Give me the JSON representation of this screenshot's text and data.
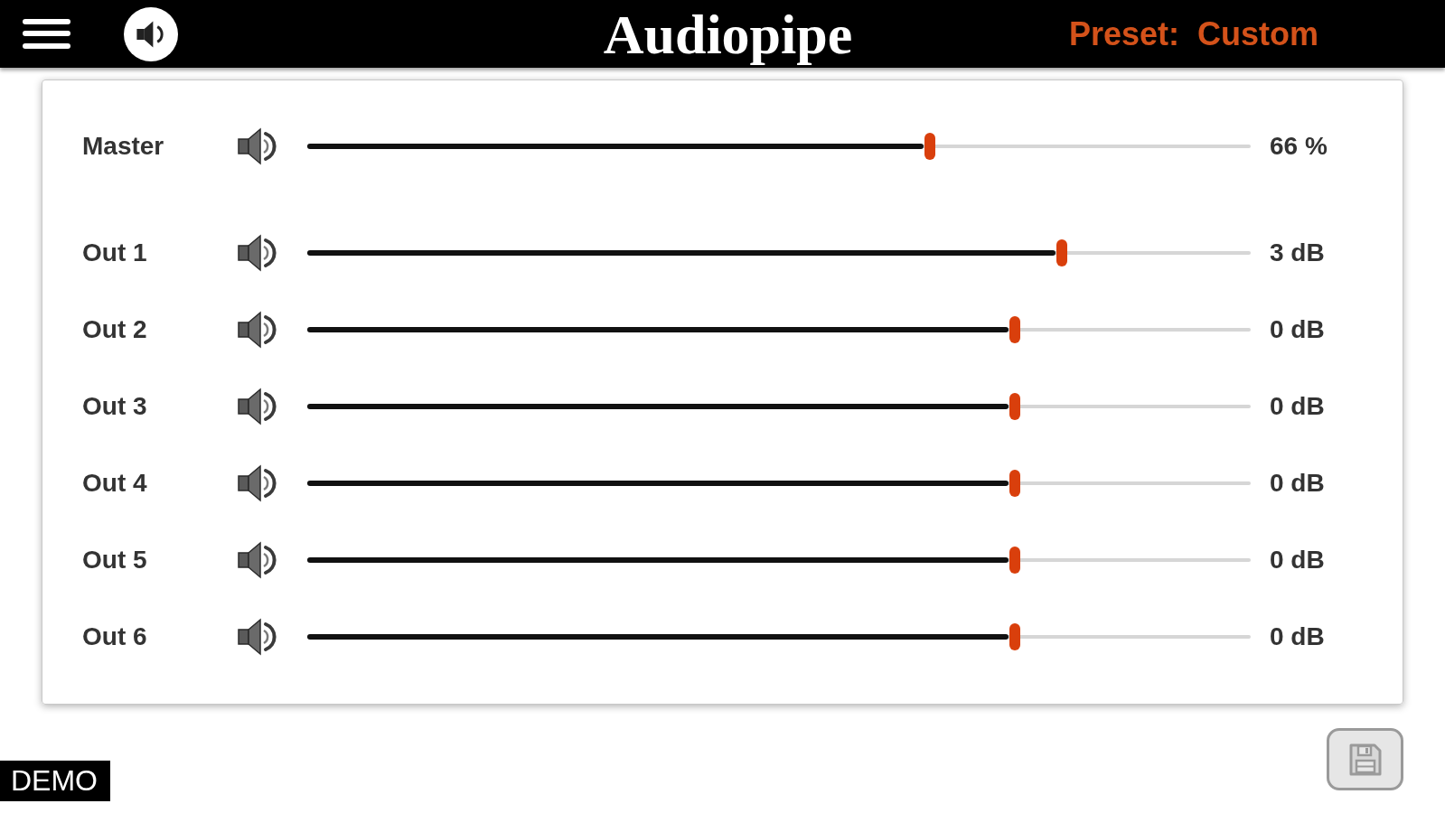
{
  "header": {
    "title": "Audiopipe",
    "preset_label": "Preset:",
    "preset_value": "Custom"
  },
  "master": {
    "name": "Master",
    "muted": false,
    "level": 0.66,
    "reading": "66 %"
  },
  "outputs": [
    {
      "name": "Out 1",
      "muted": false,
      "level": 0.8,
      "reading": "3 dB"
    },
    {
      "name": "Out 2",
      "muted": false,
      "level": 0.75,
      "reading": "0 dB"
    },
    {
      "name": "Out 3",
      "muted": false,
      "level": 0.75,
      "reading": "0 dB"
    },
    {
      "name": "Out 4",
      "muted": false,
      "level": 0.75,
      "reading": "0 dB"
    },
    {
      "name": "Out 5",
      "muted": false,
      "level": 0.75,
      "reading": "0 dB"
    },
    {
      "name": "Out 6",
      "muted": false,
      "level": 0.75,
      "reading": "0 dB"
    }
  ],
  "badge": "DEMO"
}
